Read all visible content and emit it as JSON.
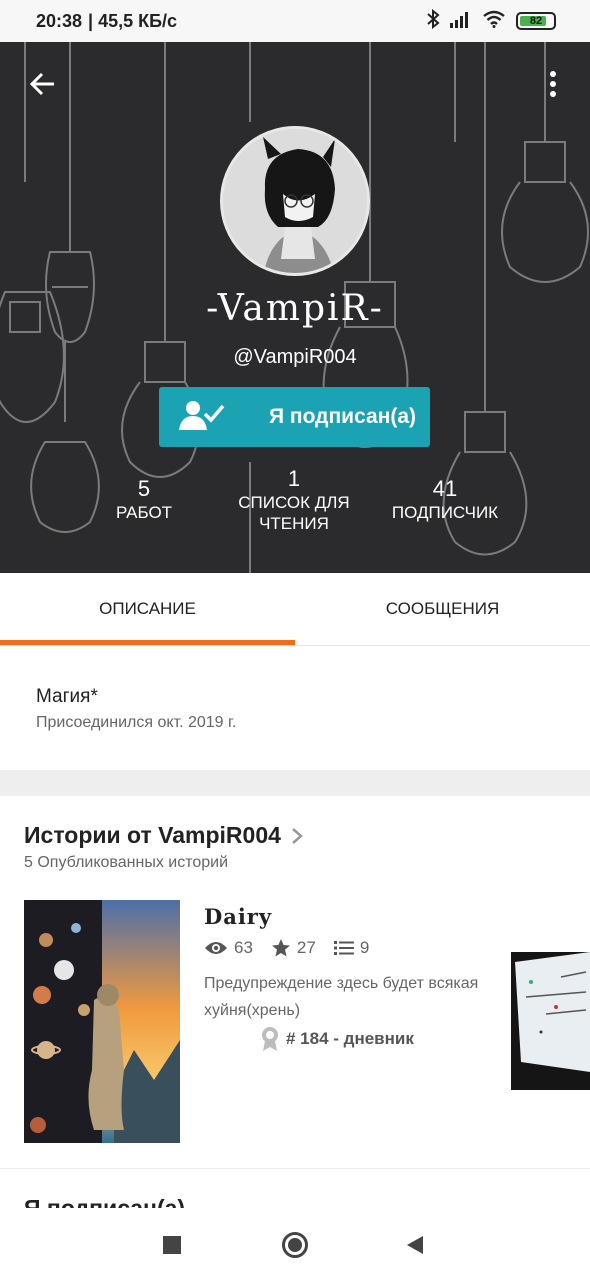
{
  "status_bar": {
    "time": "20:38",
    "speed": "| 45,5 КБ/с",
    "battery": "82",
    "battery_level": 0.82,
    "icons": [
      "bluetooth-icon",
      "signal-icon",
      "wifi-icon",
      "battery-icon"
    ]
  },
  "profile": {
    "display_name": "-VampiR-",
    "username": "@VampiR004",
    "follow_label": "Я подписан(а)",
    "stats": [
      {
        "value": "5",
        "label": "РАБОТ"
      },
      {
        "value": "1",
        "label": "СПИСОК ДЛЯ ЧТЕНИЯ"
      },
      {
        "value": "41",
        "label": "ПОДПИСЧИК"
      }
    ]
  },
  "tabs": [
    {
      "label": "ОПИСАНИЕ",
      "active": true
    },
    {
      "label": "СООБЩЕНИЯ",
      "active": false
    }
  ],
  "about": {
    "name": "Магия*",
    "joined": "Присоединился окт. 2019 г."
  },
  "stories_section": {
    "title": "Истории от VampiR004",
    "subtitle": "5 Опубликованных историй",
    "story": {
      "title": "Dairy",
      "views": "63",
      "votes": "27",
      "parts": "9",
      "description": "Предупреждение здесь будет всякая хуйня(хрень)",
      "rank": "# 184 - дневник"
    }
  },
  "following_section": {
    "title": "Я подписан(а)"
  },
  "colors": {
    "header_bg": "#2b2b2d",
    "accent": "#1ba3b3",
    "tab_indicator": "#f26a1b"
  }
}
